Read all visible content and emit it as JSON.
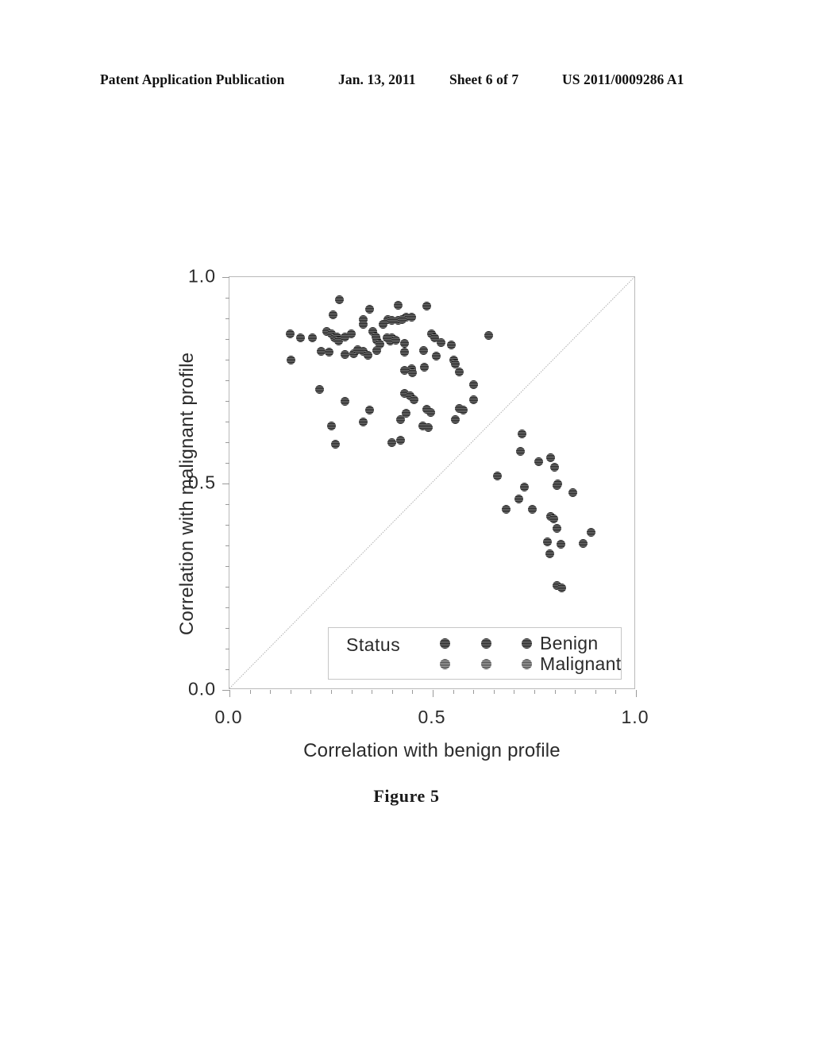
{
  "header": {
    "publication": "Patent Application Publication",
    "date": "Jan. 13, 2011",
    "sheet": "Sheet 6 of 7",
    "patent_number": "US 2011/0009286 A1"
  },
  "figure": {
    "caption": "Figure 5"
  },
  "legend": {
    "title": "Status",
    "entries": [
      {
        "label": "Benign",
        "swatch_count": 3
      },
      {
        "label": "Malignant",
        "swatch_count": 3
      }
    ]
  },
  "chart_data": {
    "type": "scatter",
    "title": "",
    "xlabel": "Correlation with benign profile",
    "ylabel": "Correlation with malignant profile",
    "xlim": [
      0.0,
      1.0
    ],
    "ylim": [
      0.0,
      1.0
    ],
    "xticks": [
      "0.0",
      "0.5",
      "1.0"
    ],
    "xtick_values": [
      0.0,
      0.5,
      1.0
    ],
    "yticks": [
      "0.0",
      "0.5",
      "1.0"
    ],
    "ytick_values": [
      0.0,
      0.5,
      1.0
    ],
    "grid": false,
    "legend_position": "inside-bottom-center",
    "reference_line": {
      "type": "identity",
      "from": [
        0.0,
        0.0
      ],
      "to": [
        1.0,
        1.0
      ]
    },
    "series": [
      {
        "name": "Malignant",
        "points": [
          [
            0.27,
            0.945
          ],
          [
            0.255,
            0.908
          ],
          [
            0.345,
            0.922
          ],
          [
            0.415,
            0.932
          ],
          [
            0.485,
            0.929
          ],
          [
            0.435,
            0.903
          ],
          [
            0.448,
            0.903
          ],
          [
            0.33,
            0.897
          ],
          [
            0.33,
            0.886
          ],
          [
            0.378,
            0.885
          ],
          [
            0.39,
            0.898
          ],
          [
            0.4,
            0.895
          ],
          [
            0.416,
            0.895
          ],
          [
            0.425,
            0.898
          ],
          [
            0.15,
            0.862
          ],
          [
            0.175,
            0.852
          ],
          [
            0.205,
            0.853
          ],
          [
            0.24,
            0.868
          ],
          [
            0.25,
            0.862
          ],
          [
            0.258,
            0.852
          ],
          [
            0.265,
            0.855
          ],
          [
            0.268,
            0.845
          ],
          [
            0.285,
            0.855
          ],
          [
            0.3,
            0.862
          ],
          [
            0.352,
            0.869
          ],
          [
            0.36,
            0.855
          ],
          [
            0.362,
            0.848
          ],
          [
            0.37,
            0.838
          ],
          [
            0.388,
            0.852
          ],
          [
            0.395,
            0.846
          ],
          [
            0.4,
            0.852
          ],
          [
            0.41,
            0.848
          ],
          [
            0.43,
            0.84
          ],
          [
            0.498,
            0.862
          ],
          [
            0.505,
            0.852
          ],
          [
            0.52,
            0.842
          ],
          [
            0.545,
            0.835
          ],
          [
            0.638,
            0.858
          ],
          [
            0.152,
            0.8
          ],
          [
            0.225,
            0.82
          ],
          [
            0.245,
            0.818
          ],
          [
            0.285,
            0.812
          ],
          [
            0.305,
            0.815
          ],
          [
            0.315,
            0.825
          ],
          [
            0.33,
            0.82
          ],
          [
            0.34,
            0.81
          ],
          [
            0.362,
            0.823
          ],
          [
            0.43,
            0.818
          ],
          [
            0.478,
            0.822
          ],
          [
            0.508,
            0.808
          ],
          [
            0.552,
            0.8
          ],
          [
            0.555,
            0.79
          ],
          [
            0.43,
            0.775
          ],
          [
            0.448,
            0.778
          ],
          [
            0.45,
            0.768
          ],
          [
            0.48,
            0.782
          ],
          [
            0.565,
            0.77
          ],
          [
            0.222,
            0.728
          ],
          [
            0.6,
            0.74
          ],
          [
            0.43,
            0.718
          ],
          [
            0.445,
            0.712
          ],
          [
            0.455,
            0.702
          ],
          [
            0.285,
            0.7
          ],
          [
            0.6,
            0.702
          ],
          [
            0.345,
            0.678
          ],
          [
            0.435,
            0.67
          ],
          [
            0.485,
            0.68
          ],
          [
            0.495,
            0.672
          ],
          [
            0.565,
            0.682
          ],
          [
            0.575,
            0.678
          ],
          [
            0.25,
            0.64
          ],
          [
            0.33,
            0.65
          ],
          [
            0.42,
            0.655
          ],
          [
            0.475,
            0.64
          ],
          [
            0.49,
            0.635
          ],
          [
            0.555,
            0.655
          ],
          [
            0.26,
            0.595
          ],
          [
            0.4,
            0.6
          ],
          [
            0.42,
            0.605
          ]
        ]
      },
      {
        "name": "Benign",
        "points": [
          [
            0.72,
            0.62
          ],
          [
            0.715,
            0.578
          ],
          [
            0.76,
            0.552
          ],
          [
            0.79,
            0.562
          ],
          [
            0.8,
            0.54
          ],
          [
            0.66,
            0.518
          ],
          [
            0.725,
            0.492
          ],
          [
            0.805,
            0.495
          ],
          [
            0.808,
            0.5
          ],
          [
            0.845,
            0.478
          ],
          [
            0.712,
            0.462
          ],
          [
            0.68,
            0.438
          ],
          [
            0.745,
            0.438
          ],
          [
            0.79,
            0.42
          ],
          [
            0.798,
            0.415
          ],
          [
            0.805,
            0.392
          ],
          [
            0.89,
            0.382
          ],
          [
            0.782,
            0.358
          ],
          [
            0.815,
            0.352
          ],
          [
            0.87,
            0.355
          ],
          [
            0.788,
            0.33
          ],
          [
            0.805,
            0.252
          ],
          [
            0.818,
            0.248
          ]
        ]
      }
    ]
  }
}
